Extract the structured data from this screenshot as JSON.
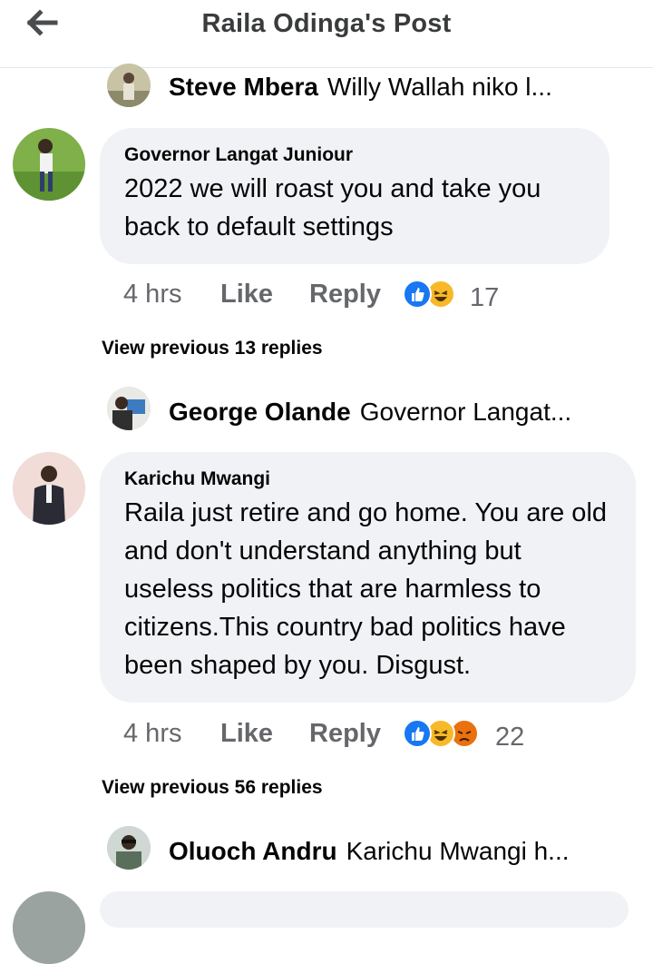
{
  "header": {
    "title": "Raila Odinga's Post"
  },
  "thread": [
    {
      "reply_preview": {
        "name": "Steve Mbera",
        "text": "Willy Wallah niko l..."
      },
      "comment": {
        "author": "Governor Langat Juniour",
        "text": "2022 we will roast you and take you back to default settings",
        "time": "4 hrs",
        "like_label": "Like",
        "reply_label": "Reply",
        "reactions": [
          "like",
          "haha"
        ],
        "reaction_count": "17"
      },
      "view_previous": "View previous 13 replies"
    },
    {
      "reply_preview": {
        "name": "George Olande",
        "text": "Governor Langat..."
      },
      "comment": {
        "author": "Karichu Mwangi",
        "text": "Raila just retire and go home. You are old and don't understand anything but useless politics that are harmless to citizens.This country bad politics have been shaped by you. Disgust.",
        "time": "4 hrs",
        "like_label": "Like",
        "reply_label": "Reply",
        "reactions": [
          "like",
          "haha",
          "angry"
        ],
        "reaction_count": "22"
      },
      "view_previous": "View previous 56 replies"
    },
    {
      "reply_preview": {
        "name": "Oluoch Andru",
        "text": "Karichu Mwangi h..."
      }
    }
  ],
  "colors": {
    "bubble": "#f0f2f5",
    "meta_text": "#65676b",
    "like_blue": "#1877f2",
    "haha_yellow": "#f7b928",
    "angry_orange": "#e9710f"
  }
}
